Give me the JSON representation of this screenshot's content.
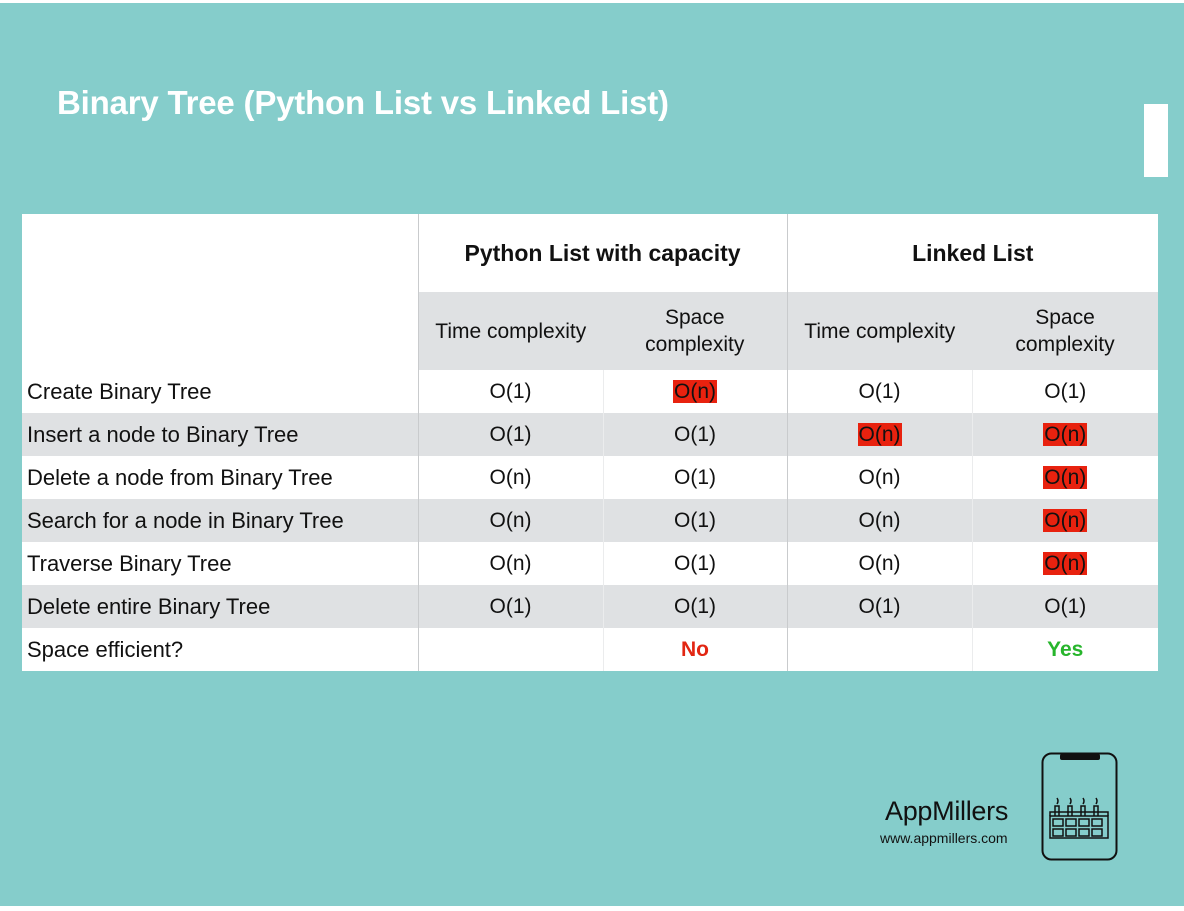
{
  "slide": {
    "title": "Binary Tree (Python List vs Linked List)"
  },
  "table": {
    "groups": [
      "Python List with capacity",
      "Linked List"
    ],
    "subheaders": [
      [
        "Time complexity",
        "Space\ncomplexity"
      ],
      [
        "Time complexity",
        "Space\ncomplexity"
      ]
    ],
    "rows": [
      {
        "label": "Create Binary Tree",
        "values": [
          "O(1)",
          "O(n)",
          "O(1)",
          "O(1)"
        ],
        "highlight": [
          false,
          true,
          false,
          false
        ]
      },
      {
        "label": "Insert a node to Binary Tree",
        "values": [
          "O(1)",
          "O(1)",
          "O(n)",
          "O(n)"
        ],
        "highlight": [
          false,
          false,
          true,
          true
        ]
      },
      {
        "label": "Delete a node from Binary Tree",
        "values": [
          "O(n)",
          "O(1)",
          "O(n)",
          "O(n)"
        ],
        "highlight": [
          false,
          false,
          false,
          true
        ]
      },
      {
        "label": "Search for a node in Binary Tree",
        "values": [
          "O(n)",
          "O(1)",
          "O(n)",
          "O(n)"
        ],
        "highlight": [
          false,
          false,
          false,
          true
        ]
      },
      {
        "label": "Traverse Binary Tree",
        "values": [
          "O(n)",
          "O(1)",
          "O(n)",
          "O(n)"
        ],
        "highlight": [
          false,
          false,
          false,
          true
        ]
      },
      {
        "label": "Delete entire Binary Tree",
        "values": [
          "O(1)",
          "O(1)",
          "O(1)",
          "O(1)"
        ],
        "highlight": [
          false,
          false,
          false,
          false
        ]
      }
    ],
    "space_efficient": {
      "label": "Space efficient?",
      "python_list": "No",
      "linked_list": "Yes"
    },
    "colors": {
      "highlight": "#e8220f",
      "no": "#e22612",
      "yes": "#27b52c"
    }
  },
  "branding": {
    "name": "AppMillers",
    "url": "www.appmillers.com",
    "logo_icon": "phone-factory-icon"
  },
  "colors": {
    "background": "#85cdcb",
    "header_gray": "#dfe1e3"
  }
}
